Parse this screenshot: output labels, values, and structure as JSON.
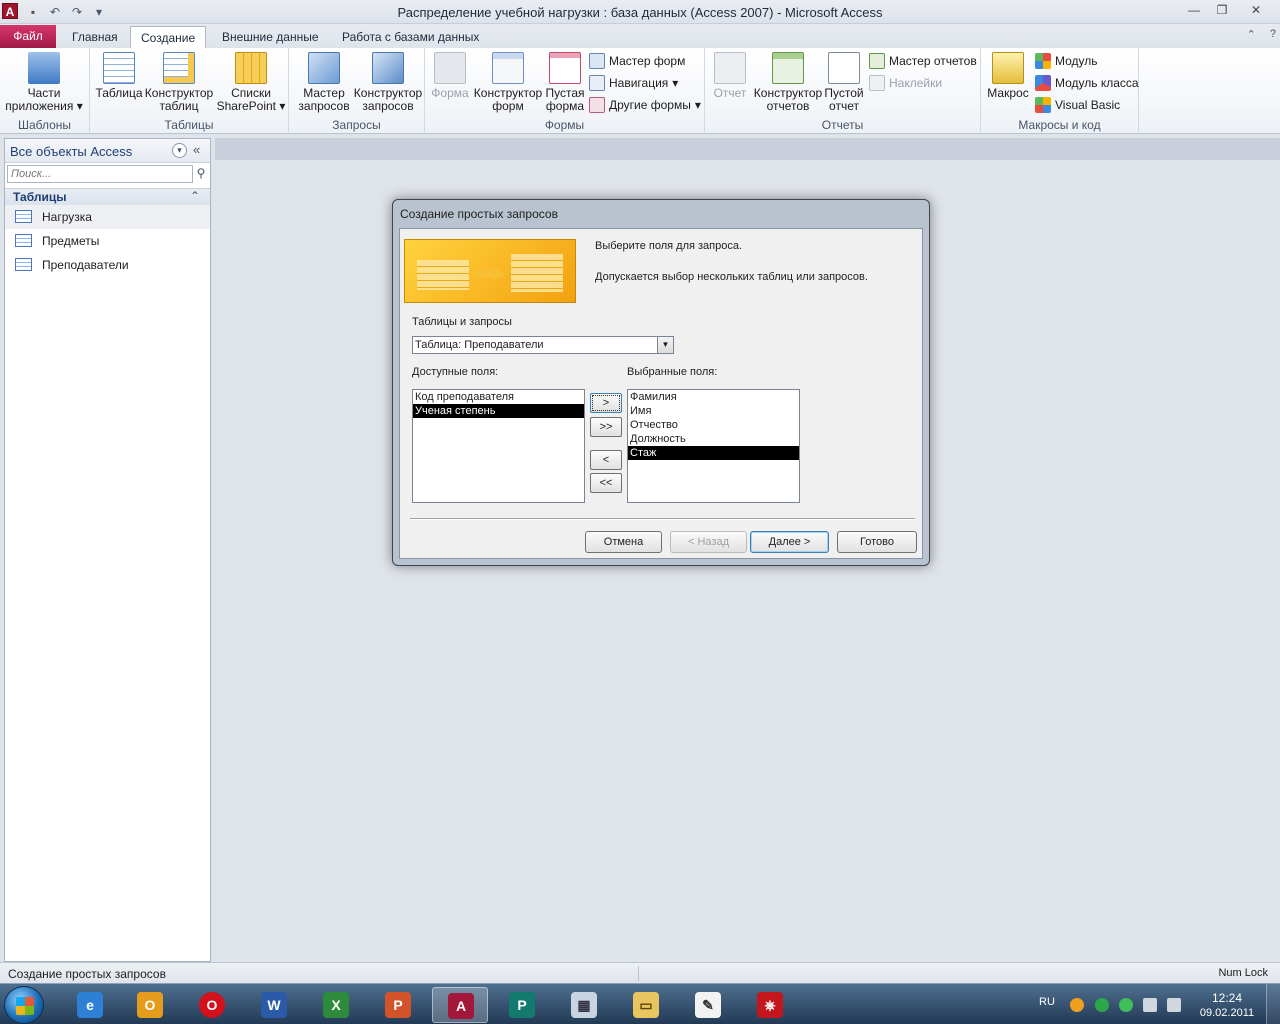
{
  "window": {
    "title": "Распределение учебной нагрузки : база данных (Access 2007)  -  Microsoft Access",
    "app_icon_letter": "A"
  },
  "tabs": {
    "file": "Файл",
    "items": [
      "Главная",
      "Создание",
      "Внешние данные",
      "Работа с базами данных"
    ],
    "active": "Создание"
  },
  "ribbon": {
    "groups": {
      "templates": "Шаблоны",
      "tables": "Таблицы",
      "queries": "Запросы",
      "forms": "Формы",
      "reports": "Отчеты",
      "macros": "Макросы и код"
    },
    "buttons": {
      "app_parts": "Части приложения",
      "table": "Таблица",
      "table_design": "Конструктор таблиц",
      "sharepoint_lists": "Списки SharePoint",
      "query_wizard": "Мастер запросов",
      "query_design": "Конструктор запросов",
      "form": "Форма",
      "form_design": "Конструктор форм",
      "blank_form": "Пустая форма",
      "form_wizard": "Мастер форм",
      "navigation": "Навигация",
      "more_forms": "Другие формы",
      "report": "Отчет",
      "report_design": "Конструктор отчетов",
      "blank_report": "Пустой отчет",
      "report_wizard": "Мастер отчетов",
      "labels": "Наклейки",
      "macro": "Макрос",
      "module": "Модуль",
      "class_module": "Модуль класса",
      "visual_basic": "Visual Basic"
    }
  },
  "nav": {
    "title": "Все объекты Access",
    "search_placeholder": "Поиск...",
    "group": "Таблицы",
    "items": [
      "Нагрузка",
      "Предметы",
      "Преподаватели"
    ]
  },
  "dialog": {
    "title": "Создание простых запросов",
    "instruction1": "Выберите поля для запроса.",
    "instruction2": "Допускается выбор нескольких таблиц или запросов.",
    "tables_label": "Таблицы и запросы",
    "table_value": "Таблица: Преподаватели",
    "available_label": "Доступные поля:",
    "selected_label": "Выбранные поля:",
    "available_fields": [
      "Код преподавателя",
      "Ученая степень"
    ],
    "available_selected": "Ученая степень",
    "selected_fields": [
      "Фамилия",
      "Имя",
      "Отчество",
      "Должность",
      "Стаж"
    ],
    "selected_selected": "Стаж",
    "move_one": ">",
    "move_all": ">>",
    "remove_one": "<",
    "remove_all": "<<",
    "cancel": "Отмена",
    "back": "< Назад",
    "next": "Далее >",
    "finish": "Готово"
  },
  "status": {
    "left": "Создание простых запросов",
    "right": "Num Lock"
  },
  "taskbar": {
    "lang": "RU",
    "time": "12:24",
    "date": "09.02.2011",
    "apps": [
      "internet-explorer",
      "outlook",
      "opera",
      "word",
      "excel",
      "powerpoint",
      "access",
      "publisher",
      "calculator",
      "explorer",
      "notepad-scripts",
      "acrobat"
    ],
    "active_app": "access"
  },
  "colors": {
    "file_tab": "#b81e52",
    "accent": "#1f3f73",
    "selection": "#000000"
  }
}
